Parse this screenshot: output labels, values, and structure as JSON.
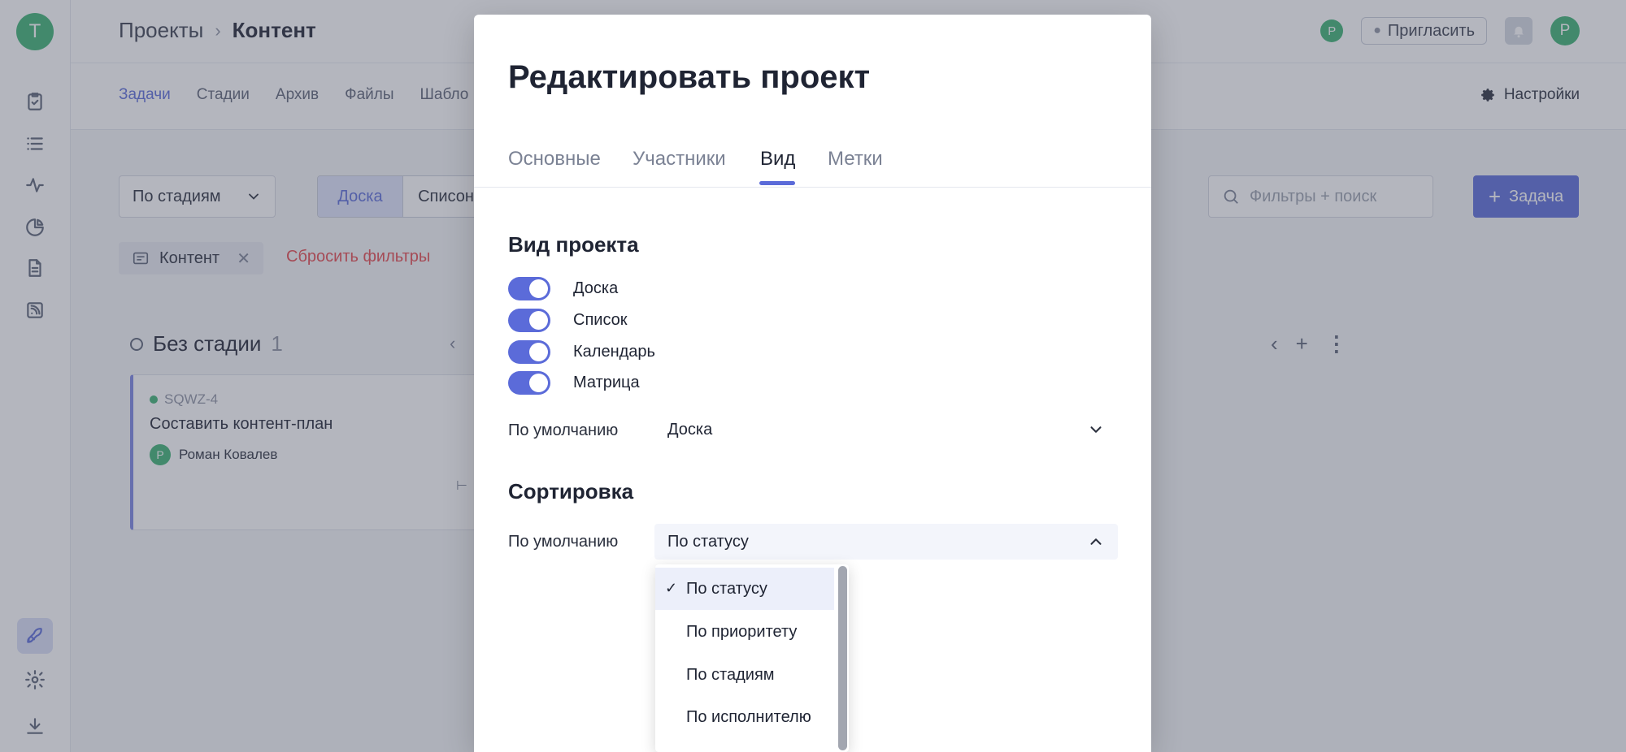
{
  "sidebar": {
    "avatar_letter": "Т",
    "icons": [
      "tasks-icon",
      "list-icon",
      "activity-icon",
      "reports-icon",
      "document-icon",
      "feed-icon",
      "rocket-icon",
      "settings-icon",
      "download-icon"
    ]
  },
  "header": {
    "breadcrumb": {
      "parent": "Проекты",
      "current": "Контент"
    },
    "presence_avatar": "Р",
    "invite_label": "Пригласить",
    "user_avatar": "Р"
  },
  "subnav": {
    "tabs": [
      "Задачи",
      "Стадии",
      "Архив",
      "Файлы",
      "Шабло"
    ],
    "settings_label": "Настройки"
  },
  "toolbar": {
    "group_by": "По стадиям",
    "view_board": "Доска",
    "view_list": "Списон",
    "search_placeholder": "Фильтры + поиск",
    "add_task": "Задача"
  },
  "filters": {
    "chip_label": "Контент",
    "reset_label": "Сбросить фильтры"
  },
  "board": {
    "column": {
      "title": "Без стадии",
      "count": "1"
    },
    "card": {
      "id": "SQWZ-4",
      "title": "Составить контент-план",
      "assignee_initial": "Р",
      "assignee": "Роман Ковалев"
    }
  },
  "modal": {
    "title": "Редактировать проект",
    "tabs": [
      "Основные",
      "Участники",
      "Вид",
      "Метки"
    ],
    "active_tab": "Вид",
    "view_section": {
      "title": "Вид проекта",
      "toggles": [
        {
          "label": "Доска",
          "on": true
        },
        {
          "label": "Список",
          "on": true
        },
        {
          "label": "Календарь",
          "on": true
        },
        {
          "label": "Матрица",
          "on": true
        }
      ],
      "default_label": "По умолчанию",
      "default_value": "Доска"
    },
    "sort_section": {
      "title": "Сортировка",
      "default_label": "По умолчанию",
      "default_value": "По статусу",
      "options": [
        "По статусу",
        "По приоритету",
        "По стадиям",
        "По исполнителю"
      ],
      "selected_option": "По статусу"
    }
  },
  "colors": {
    "accent": "#5b6bd9",
    "success": "#3bb273",
    "danger": "#e5484d"
  }
}
